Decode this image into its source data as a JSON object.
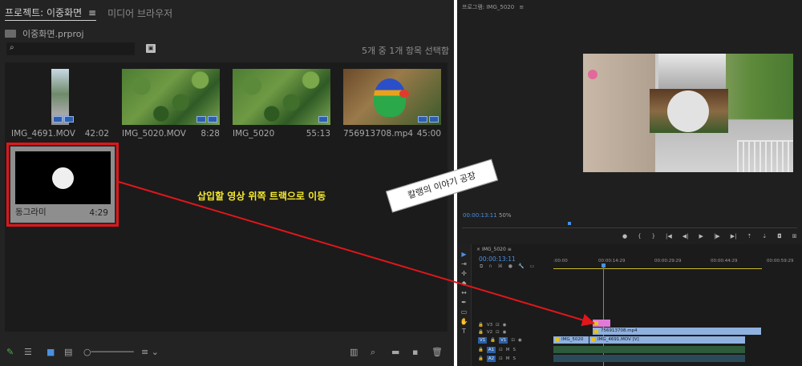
{
  "project_panel": {
    "tab_active": "프로젝트: 이중화면",
    "tab_menu_glyph": "≡",
    "tab_inactive": "미디어 브라우저",
    "project_file": "이중화면.prproj",
    "search_placeholder": "",
    "selection_status": "5개 중 1개 항목 선택함",
    "clips": [
      {
        "name": "IMG_4691.MOV",
        "duration": "42:02"
      },
      {
        "name": "IMG_5020.MOV",
        "duration": "8:28"
      },
      {
        "name": "IMG_5020",
        "duration": "55:13"
      },
      {
        "name": "756913708.mp4",
        "duration": "45:00"
      }
    ],
    "selected_clip": {
      "name": "동그라미",
      "duration": "4:29"
    }
  },
  "annotation": {
    "text": "삽입할 영상 위쪽 트랙으로 이동",
    "color": "#f5e92c",
    "arrow_color": "#e0161a"
  },
  "program_monitor": {
    "title": "프로그램: IMG_5020",
    "title_glyph": "≡",
    "timecode": "00:00:13:11",
    "zoom": "50%"
  },
  "timeline": {
    "sequence_name": "IMG_5020",
    "timecode": "00:00:13:11",
    "ruler_labels": [
      ":00:00",
      "00:00:14:29",
      "00:00:29:29",
      "00:00:44:29",
      "00:00:59:29"
    ],
    "tracks": [
      {
        "name": "V3"
      },
      {
        "name": "V2"
      },
      {
        "name": "V1",
        "source": "V1"
      },
      {
        "name": "A1",
        "source": "A1"
      },
      {
        "name": "A2"
      }
    ],
    "clip_labels": {
      "v2": "756913708.mp4",
      "v1_a": "IMG_5020",
      "v1_b": "IMG_4691.MOV [V]"
    }
  },
  "watermark": {
    "text": "칼랭의 이야기 공장"
  },
  "colors": {
    "accent_blue": "#4a90e2",
    "highlight_red": "#e0161a",
    "panel_bg": "#232323"
  }
}
